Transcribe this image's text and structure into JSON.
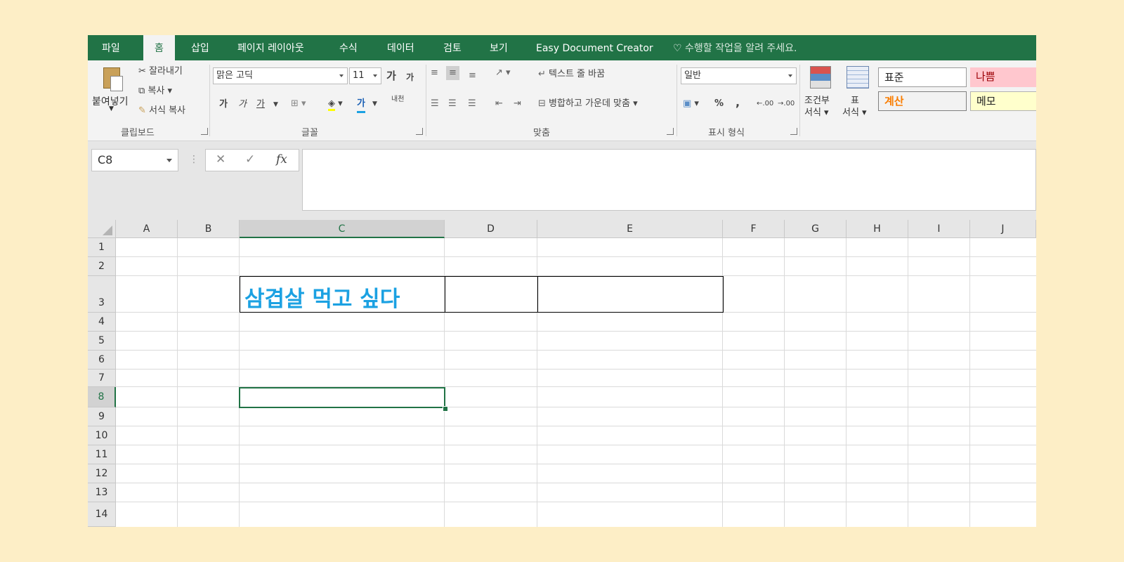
{
  "tabs": [
    "파일",
    "홈",
    "삽입",
    "페이지 레이아웃",
    "수식",
    "데이터",
    "검토",
    "보기",
    "Easy Document Creator"
  ],
  "tell_me": "수행할 작업을 알려 주세요.",
  "clipboard": {
    "paste": "붙여넣기",
    "cut": "잘라내기",
    "copy": "복사",
    "format_painter": "서식 복사",
    "group": "클립보드"
  },
  "font": {
    "name": "맑은 고딕",
    "size": "11",
    "grow": "가",
    "shrink": "가",
    "bold": "가",
    "italic": "가",
    "underline": "가",
    "font_color": "가",
    "phonetic": "내천",
    "group": "글꼴"
  },
  "alignment": {
    "wrap_text": "텍스트 줄 바꿈",
    "merge_center": "병합하고 가운데 맞춤",
    "group": "맞춤"
  },
  "number": {
    "format": "일반",
    "percent": "%",
    "comma": ",",
    "inc_decimal": ".00",
    "dec_decimal": ".00",
    "group": "표시 형식"
  },
  "styles": {
    "conditional_1": "조건부",
    "conditional_2": "서식",
    "table_1": "표",
    "table_2": "서식",
    "normal": "표준",
    "bad": "나쁨",
    "calculation": "계산",
    "note": "메모"
  },
  "formula_bar": {
    "name_box": "C8",
    "cancel": "✕",
    "enter": "✓",
    "fx": "fx",
    "content": ""
  },
  "columns": [
    "A",
    "B",
    "C",
    "D",
    "E",
    "F",
    "G",
    "H",
    "I",
    "J"
  ],
  "rows": [
    "1",
    "2",
    "3",
    "4",
    "5",
    "6",
    "7",
    "8",
    "9",
    "10",
    "11",
    "12",
    "13",
    "14"
  ],
  "cells": {
    "C3": "삼겹살 먹고 싶다"
  },
  "colors": {
    "accent": "#217346",
    "c3_text": "#1ba1e2",
    "bad_bg": "#ffc7ce",
    "bad_text": "#9c0006",
    "calc_text": "#fa7d00",
    "note_bg": "#ffffcc"
  }
}
